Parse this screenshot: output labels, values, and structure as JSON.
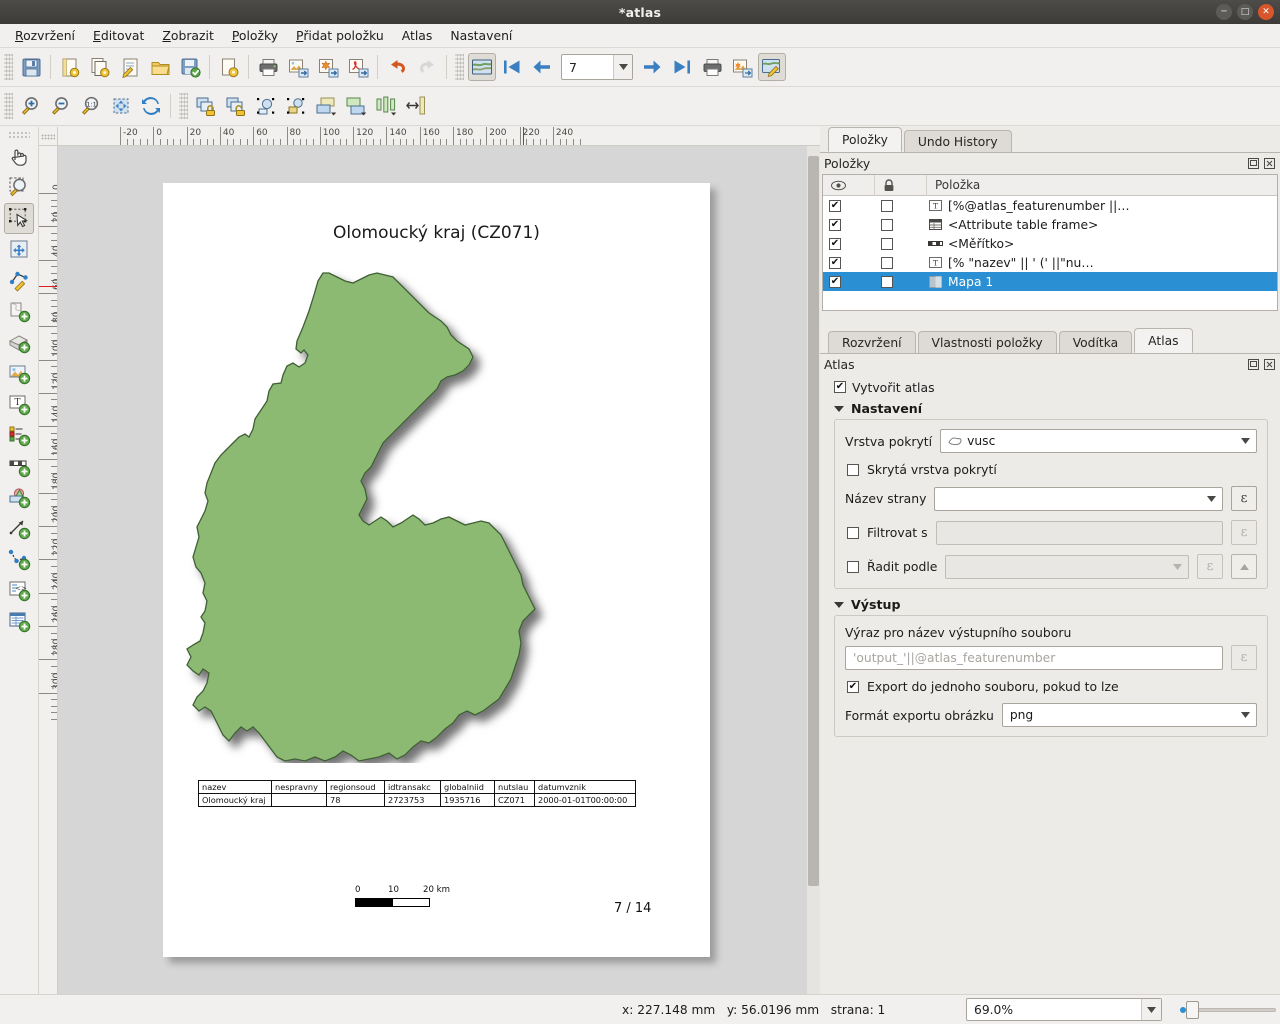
{
  "window": {
    "title": "*atlas"
  },
  "menubar": [
    {
      "label": "Rozvržení"
    },
    {
      "label": "Editovat"
    },
    {
      "label": "Zobrazit"
    },
    {
      "label": "Položky"
    },
    {
      "label": "Přidat položku"
    },
    {
      "label": "Atlas"
    },
    {
      "label": "Nastavení"
    }
  ],
  "toolbar_main": [
    {
      "name": "save-layout-button",
      "icon": "save-icon"
    },
    {
      "name": "new-layout-button",
      "icon": "new-layout-icon"
    },
    {
      "name": "duplicate-layout-button",
      "icon": "duplicate-layout-icon"
    },
    {
      "name": "layout-manager-button",
      "icon": "layout-manager-icon"
    },
    {
      "name": "open-template-button",
      "icon": "folder-icon"
    },
    {
      "name": "save-template-button",
      "icon": "save-template-icon"
    },
    {
      "name": "new-from-template-button",
      "icon": "page-gear-icon"
    },
    {
      "name": "print-button",
      "icon": "printer-icon"
    },
    {
      "name": "export-image-button",
      "icon": "export-image-icon"
    },
    {
      "name": "export-svg-button",
      "icon": "export-svg-icon"
    },
    {
      "name": "export-pdf-button",
      "icon": "export-pdf-icon"
    },
    {
      "name": "undo-button",
      "icon": "undo-arrow-icon"
    },
    {
      "name": "redo-button",
      "icon": "redo-arrow-icon"
    }
  ],
  "toolbar_atlas": {
    "preview_atlas_label": "",
    "page_value": "7",
    "buttons": [
      {
        "name": "atlas-preview-toggle",
        "icon": "atlas-preview-icon"
      },
      {
        "name": "atlas-first-feature-button",
        "icon": "first-arrow-icon"
      },
      {
        "name": "atlas-prev-feature-button",
        "icon": "prev-arrow-icon"
      },
      {
        "name": "atlas-next-feature-button",
        "icon": "next-arrow-icon"
      },
      {
        "name": "atlas-last-feature-button",
        "icon": "last-arrow-icon"
      },
      {
        "name": "atlas-print-button",
        "icon": "printer-icon"
      },
      {
        "name": "atlas-export-image-button",
        "icon": "export-image-icon"
      },
      {
        "name": "atlas-settings-button",
        "icon": "atlas-settings-icon"
      }
    ]
  },
  "toolbar_nav": [
    {
      "name": "zoom-in-button",
      "icon": "zoom-in-icon"
    },
    {
      "name": "zoom-out-button",
      "icon": "zoom-out-icon"
    },
    {
      "name": "zoom-full-button",
      "icon": "zoom-one-to-one-icon"
    },
    {
      "name": "zoom-to-extent-button",
      "icon": "zoom-extent-icon"
    },
    {
      "name": "refresh-view-button",
      "icon": "refresh-icon"
    },
    {
      "name": "lock-items-button",
      "icon": "lock-icon"
    },
    {
      "name": "unlock-items-button",
      "icon": "unlock-icon"
    },
    {
      "name": "group-items-button",
      "icon": "group-icon"
    },
    {
      "name": "ungroup-items-button",
      "icon": "ungroup-icon"
    },
    {
      "name": "raise-items-button",
      "icon": "raise-icon"
    },
    {
      "name": "lower-items-button",
      "icon": "lower-icon"
    },
    {
      "name": "align-items-button",
      "icon": "align-icon"
    },
    {
      "name": "distribute-items-button",
      "icon": "distribute-icon"
    }
  ],
  "toolbar_left": [
    {
      "name": "pan-layout-tool",
      "icon": "hand-icon"
    },
    {
      "name": "zoom-tool",
      "icon": "magnifier-icon"
    },
    {
      "name": "select-move-item-tool",
      "icon": "select-arrow-icon",
      "checked": true
    },
    {
      "name": "move-item-content-tool",
      "icon": "move-content-icon"
    },
    {
      "name": "edit-nodes-tool",
      "icon": "edit-nodes-icon"
    },
    {
      "name": "add-map-tool",
      "icon": "add-map-icon"
    },
    {
      "name": "add-3d-map-tool",
      "icon": "add-3dmap-icon"
    },
    {
      "name": "add-picture-tool",
      "icon": "add-picture-icon"
    },
    {
      "name": "add-label-tool",
      "icon": "add-label-icon"
    },
    {
      "name": "add-legend-tool",
      "icon": "add-legend-icon"
    },
    {
      "name": "add-scalebar-tool",
      "icon": "add-scalebar-icon"
    },
    {
      "name": "add-shape-tool",
      "icon": "add-shape-icon"
    },
    {
      "name": "add-arrow-tool",
      "icon": "add-arrow-icon"
    },
    {
      "name": "add-node-item-tool",
      "icon": "add-node-item-icon"
    },
    {
      "name": "add-html-tool",
      "icon": "add-html-icon"
    },
    {
      "name": "add-attribute-table-tool",
      "icon": "add-table-icon"
    }
  ],
  "rulers": {
    "horizontal": {
      "labels": [
        "-20",
        "0",
        "20",
        "40",
        "60",
        "80",
        "100",
        "120",
        "140",
        "160",
        "180",
        "200",
        "220",
        "240"
      ],
      "marker_mm": 222
    },
    "vertical": {
      "labels": [
        "0",
        "20",
        "40",
        "60",
        "80",
        "100",
        "120",
        "140",
        "160",
        "180",
        "200",
        "220",
        "240",
        "260",
        "280",
        "300"
      ],
      "marker_mm": 56
    }
  },
  "layout_page": {
    "title": "Olomoucký kraj (CZ071)",
    "attribute_table": {
      "headers": [
        "nazev",
        "nespravny",
        "regionsoud",
        "idtransakc",
        "globalniid",
        "nutslau",
        "datumvznik"
      ],
      "rows": [
        [
          "Olomoucký kraj",
          "",
          "78",
          "2723753",
          "1935716",
          "CZ071",
          "2000-01-01T00:00:00"
        ]
      ]
    },
    "scalebar": {
      "labels": [
        "0",
        "10",
        "20 km"
      ]
    },
    "page_label": "7 / 14",
    "map_fill_color": "#8cba73",
    "map_stroke_color": "#3f5f35"
  },
  "dock": {
    "top_tabs": [
      {
        "label": "Položky",
        "active": true,
        "name": "tab-items"
      },
      {
        "label": "Undo History",
        "active": false,
        "name": "tab-undo-history"
      }
    ],
    "items_panel": {
      "title": "Položky",
      "columns": [
        "eye-icon",
        "lock-icon",
        "Položka"
      ],
      "column_label": "Položka",
      "rows": [
        {
          "visible": true,
          "locked": false,
          "icon": "label-item-icon",
          "label": "[%@atlas_featurenumber ||…",
          "selected": false
        },
        {
          "visible": true,
          "locked": false,
          "icon": "attribute-table-item-icon",
          "label": "<Attribute table frame>",
          "selected": false
        },
        {
          "visible": true,
          "locked": false,
          "icon": "scalebar-item-icon",
          "label": "<Měřítko>",
          "selected": false
        },
        {
          "visible": true,
          "locked": false,
          "icon": "label-item-icon",
          "label": "[% \"nazev\" || ' (' ||\"nu…",
          "selected": false
        },
        {
          "visible": true,
          "locked": false,
          "icon": "map-item-icon",
          "label": "Mapa 1",
          "selected": true
        }
      ]
    },
    "bottom_tabs": [
      {
        "label": "Rozvržení",
        "active": false,
        "name": "tab-layout"
      },
      {
        "label": "Vlastnosti položky",
        "active": false,
        "name": "tab-item-properties"
      },
      {
        "label": "Vodítka",
        "active": false,
        "name": "tab-guides"
      },
      {
        "label": "Atlas",
        "active": true,
        "name": "tab-atlas"
      }
    ],
    "atlas_panel": {
      "title": "Atlas",
      "generate_atlas": {
        "label": "Vytvořit atlas",
        "checked": true
      },
      "settings": {
        "group_label": "Nastavení",
        "coverage_layer_label": "Vrstva pokrytí",
        "coverage_layer_value": "vusc",
        "hidden_coverage_label": "Skrytá vrstva pokrytí",
        "hidden_coverage_checked": false,
        "page_name_label": "Název strany",
        "page_name_value": "",
        "filter_label": "Filtrovat s",
        "filter_checked": false,
        "filter_value": "",
        "sort_label": "Řadit podle",
        "sort_checked": false,
        "sort_value": "",
        "expression_button_label": "ε"
      },
      "output": {
        "group_label": "Výstup",
        "filename_expression_label": "Výraz pro název výstupního souboru",
        "filename_expression_placeholder": "'output_'||@atlas_featurenumber",
        "single_file_label": "Export do jednoho souboru, pokud to lze",
        "single_file_checked": true,
        "image_format_label": "Formát exportu obrázku",
        "image_format_value": "png"
      }
    }
  },
  "statusbar": {
    "coordinates": "x: 227.148 mm   y: 56.0196 mm   strana: 1",
    "zoom_value": "69.0%"
  },
  "colors": {
    "selection_blue": "#2b8fd4",
    "chrome": "#f2f0ee",
    "canvas_bg": "#d6d6d6"
  }
}
